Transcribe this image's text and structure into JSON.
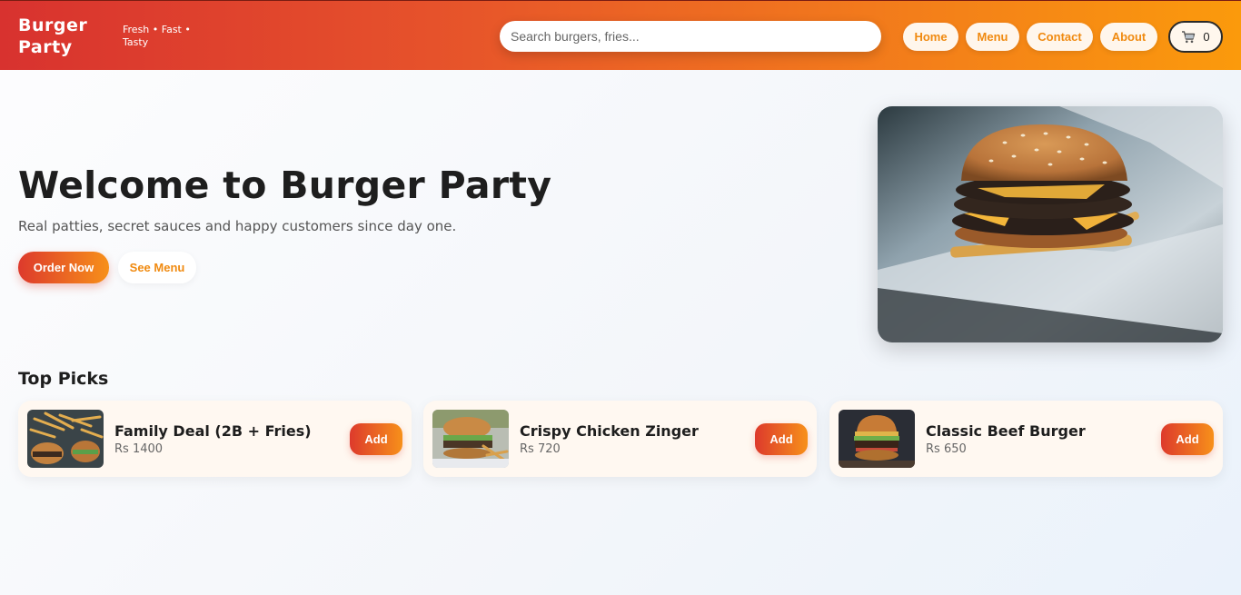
{
  "header": {
    "brand": "Burger Party",
    "tagline": "Fresh • Fast • Tasty",
    "search_placeholder": "Search burgers, fries...",
    "nav": [
      {
        "label": "Home"
      },
      {
        "label": "Menu"
      },
      {
        "label": "Contact"
      },
      {
        "label": "About"
      }
    ],
    "cart": {
      "icon": "cart-icon",
      "count": "0"
    }
  },
  "hero": {
    "title": "Welcome to Burger Party",
    "subtitle": "Real patties, secret sauces and happy customers since day one.",
    "order_label": "Order Now",
    "menu_label": "See Menu",
    "image": "burger-photo"
  },
  "top_picks": {
    "title": "Top Picks",
    "items": [
      {
        "name": "Family Deal (2B + Fries)",
        "price": "Rs 1400",
        "add_label": "Add",
        "image": "family-deal-photo"
      },
      {
        "name": "Crispy Chicken Zinger",
        "price": "Rs 720",
        "add_label": "Add",
        "image": "chicken-zinger-photo"
      },
      {
        "name": "Classic Beef Burger",
        "price": "Rs 650",
        "add_label": "Add",
        "image": "beef-burger-photo"
      }
    ]
  },
  "colors": {
    "header_start": "#d8322f",
    "header_end": "#fb9a0c",
    "accent": "#f08a10"
  }
}
